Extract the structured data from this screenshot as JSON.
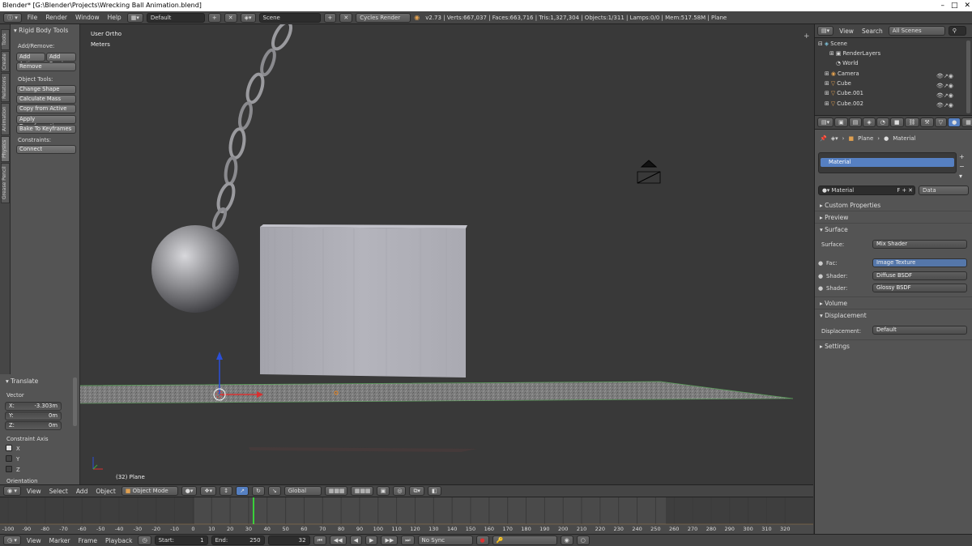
{
  "title_bar": {
    "text": "Blender* [G:\\Blender\\Projects\\Wrecking Ball Animation.blend]"
  },
  "info_header": {
    "menus": [
      "File",
      "Render",
      "Window",
      "Help"
    ],
    "layout": "Default",
    "scene": "Scene",
    "engine": "Cycles Render",
    "stats": "v2.73 | Verts:667,037 | Faces:663,716 | Tris:1,327,304 | Objects:1/311 | Lamps:0/0 | Mem:517.58M | Plane"
  },
  "tool_shelf": {
    "tabs": [
      "Tools",
      "Create",
      "Relations",
      "Animation",
      "Physics",
      "Grease Pencil"
    ],
    "panel_title": "Rigid Body Tools",
    "add_remove_label": "Add/Remove:",
    "add_active": "Add Activ",
    "add_passive": "Add Passi",
    "remove": "Remove",
    "object_tools_label": "Object Tools:",
    "change_shape": "Change Shape",
    "calculate_mass": "Calculate Mass",
    "copy_from_active": "Copy from Active",
    "apply_transformation": "Apply Transformation",
    "bake_to_keyframes": "Bake To Keyframes",
    "constraints_label": "Constraints:",
    "connect": "Connect"
  },
  "redo_panel": {
    "title": "Translate",
    "vector_label": "Vector",
    "x_label": "X:",
    "x_value": "-3.303m",
    "y_label": "Y:",
    "y_value": "0m",
    "z_label": "Z:",
    "z_value": "0m",
    "constraint_axis_label": "Constraint Axis",
    "axis_x": "X",
    "axis_y": "Y",
    "axis_z": "Z",
    "orientation_label": "Orientation"
  },
  "viewport": {
    "view_name": "User Ortho",
    "units": "Meters",
    "object_info": "(32) Plane"
  },
  "viewport_header": {
    "menus": [
      "View",
      "Select",
      "Add",
      "Object"
    ],
    "mode": "Object Mode",
    "orientation": "Global"
  },
  "timeline": {
    "frame_labels": [
      "-100",
      "-90",
      "-80",
      "-70",
      "-60",
      "-50",
      "-40",
      "-30",
      "-20",
      "-10",
      "0",
      "10",
      "20",
      "30",
      "40",
      "50",
      "60",
      "70",
      "80",
      "90",
      "100",
      "110",
      "120",
      "130",
      "140",
      "150",
      "160",
      "170",
      "180",
      "190",
      "200",
      "210",
      "220",
      "230",
      "240",
      "250",
      "260",
      "270",
      "280",
      "290",
      "300",
      "310",
      "320"
    ],
    "current_frame": 32
  },
  "timeline_header": {
    "menus": [
      "View",
      "Marker",
      "Frame",
      "Playback"
    ],
    "start_label": "Start:",
    "start_value": "1",
    "end_label": "End:",
    "end_value": "250",
    "current": "32",
    "sync": "No Sync"
  },
  "outliner": {
    "header_menus": [
      "View",
      "Search"
    ],
    "scene_filter": "All Scenes",
    "rows": [
      "Scene",
      "RenderLayers",
      "World",
      "Camera",
      "Cube",
      "Cube.001",
      "Cube.002"
    ]
  },
  "properties": {
    "breadcrumb_object": "Plane",
    "breadcrumb_material": "Material",
    "slot_name": "Material",
    "material_name": "Material",
    "fake_user": "F",
    "link_mode": "Data",
    "sections": {
      "custom_properties": "Custom Properties",
      "preview": "Preview",
      "surface": "Surface",
      "volume": "Volume",
      "displacement": "Displacement",
      "settings": "Settings"
    },
    "surface_label": "Surface:",
    "surface_value": "Mix Shader",
    "fac_label": "Fac:",
    "fac_value": "Image Texture",
    "shader1_label": "Shader:",
    "shader1_value": "Diffuse BSDF",
    "shader2_label": "Shader:",
    "shader2_value": "Glossy BSDF",
    "displacement_label": "Displacement:",
    "displacement_value": "Default"
  },
  "colors": {
    "accent_blue": "#5680c2",
    "current_frame_green": "#3ad03a",
    "panel_bg": "#545454",
    "viewport_bg": "#393939"
  }
}
